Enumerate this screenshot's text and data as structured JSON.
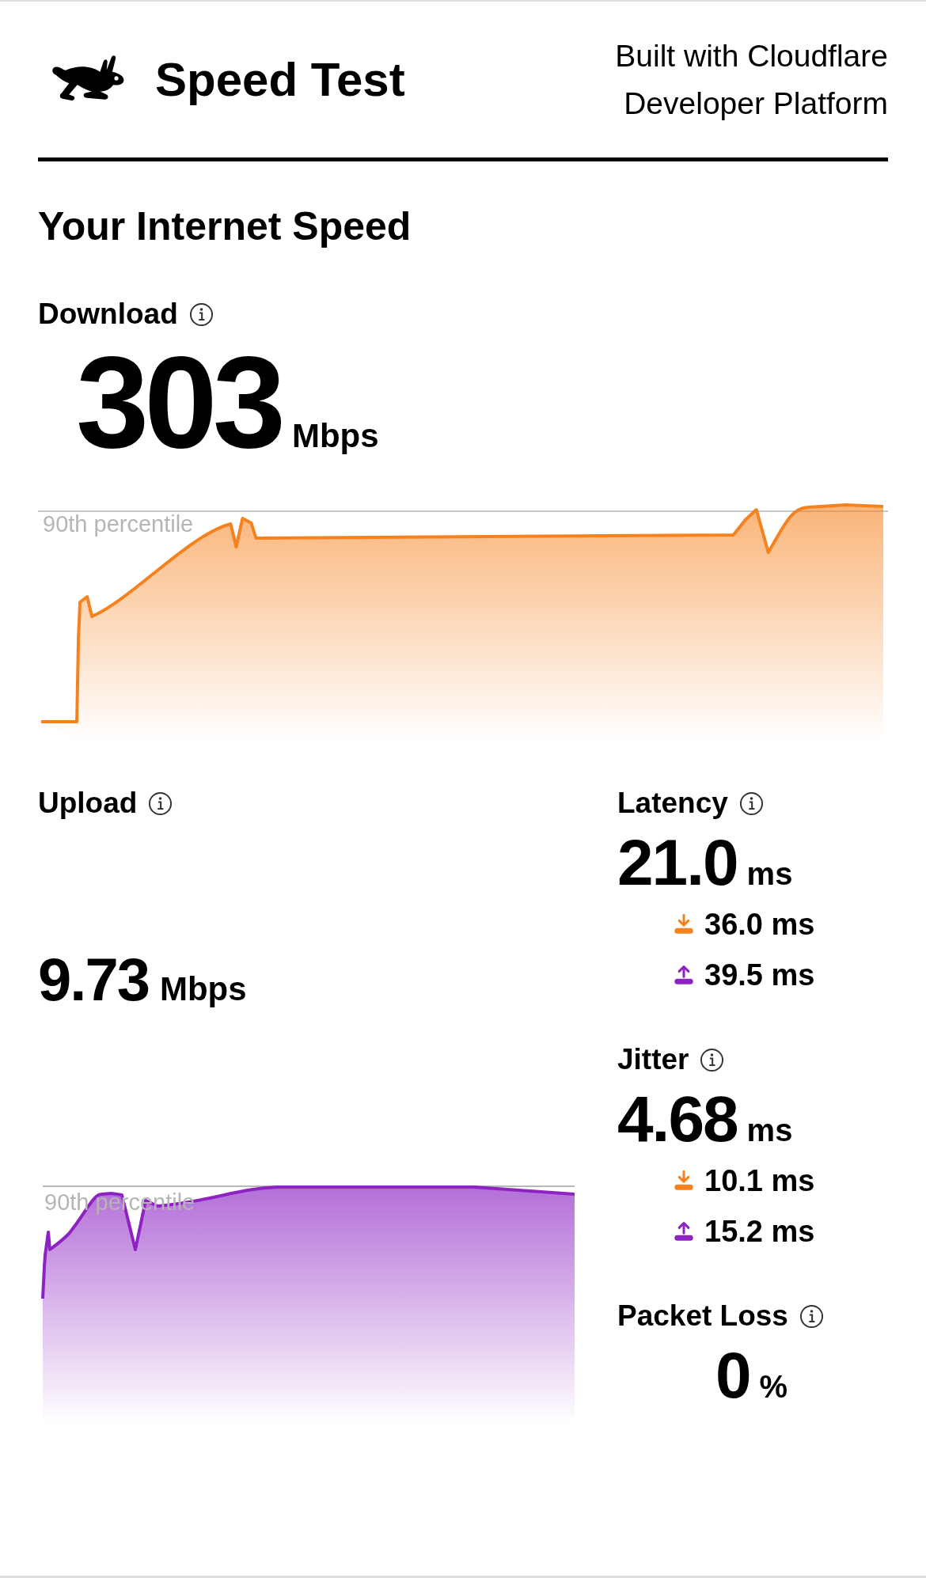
{
  "header": {
    "title": "Speed Test",
    "credit_lines": [
      "Built with Cloudflare",
      "Developer Platform"
    ]
  },
  "heading": "Your Internet Speed",
  "download": {
    "label": "Download",
    "value": "303",
    "unit": "Mbps",
    "percentile_label": "90th percentile"
  },
  "upload": {
    "label": "Upload",
    "value": "9.73",
    "unit": "Mbps",
    "percentile_label": "90th percentile"
  },
  "metrics": [
    {
      "label": "Latency",
      "value": "21.0",
      "unit": "ms",
      "breakdown": [
        {
          "kind": "download",
          "value": "36.0 ms"
        },
        {
          "kind": "upload",
          "value": "39.5 ms"
        }
      ]
    },
    {
      "label": "Jitter",
      "value": "4.68",
      "unit": "ms",
      "breakdown": [
        {
          "kind": "download",
          "value": "10.1 ms"
        },
        {
          "kind": "upload",
          "value": "15.2 ms"
        }
      ]
    },
    {
      "label": "Packet Loss",
      "value": "0",
      "unit": "%",
      "centered": true
    }
  ]
}
